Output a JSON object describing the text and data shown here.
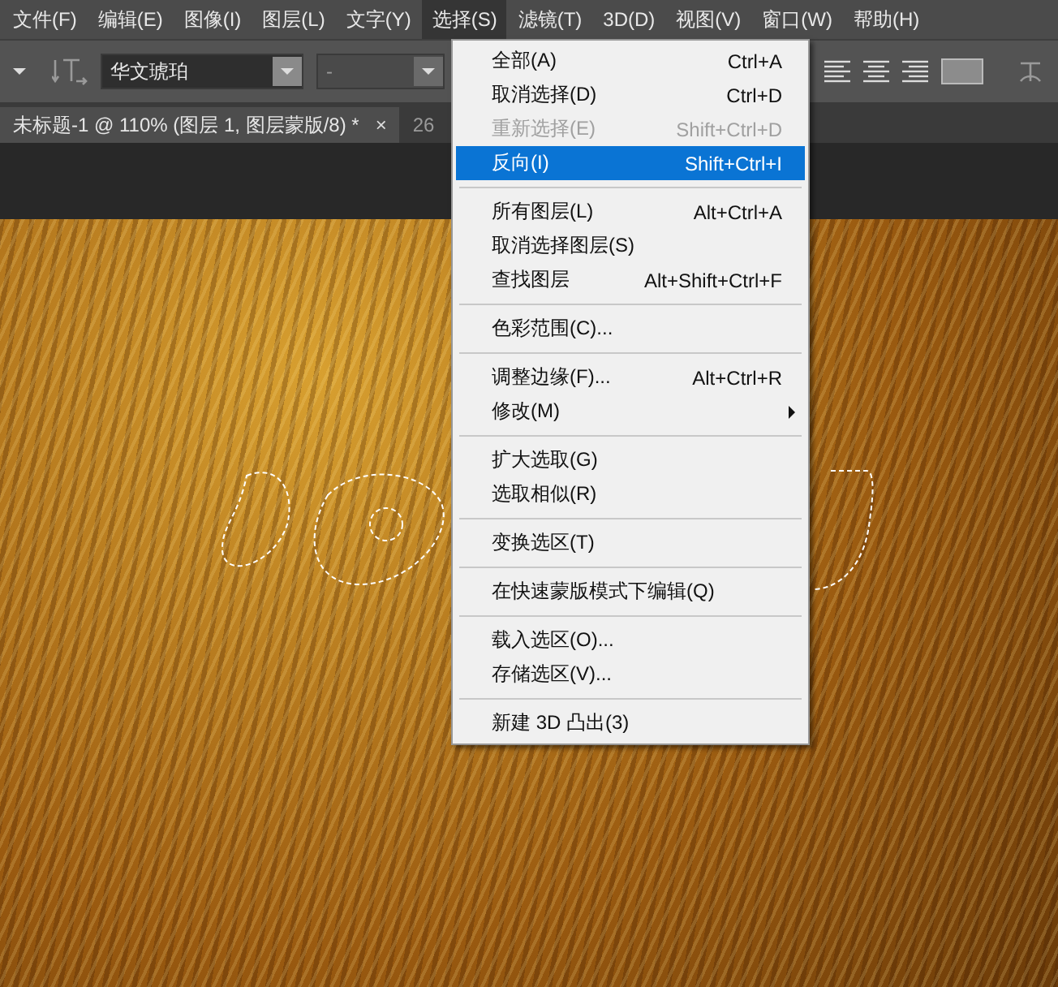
{
  "menubar": [
    {
      "label": "文件(F)",
      "selected": false
    },
    {
      "label": "编辑(E)",
      "selected": false
    },
    {
      "label": "图像(I)",
      "selected": false
    },
    {
      "label": "图层(L)",
      "selected": false
    },
    {
      "label": "文字(Y)",
      "selected": false
    },
    {
      "label": "选择(S)",
      "selected": true
    },
    {
      "label": "滤镜(T)",
      "selected": false
    },
    {
      "label": "3D(D)",
      "selected": false
    },
    {
      "label": "视图(V)",
      "selected": false
    },
    {
      "label": "窗口(W)",
      "selected": false
    },
    {
      "label": "帮助(H)",
      "selected": false
    }
  ],
  "options_bar": {
    "font_family": "华文琥珀",
    "font_style": "-"
  },
  "document_tabs": [
    {
      "label": "未标题-1 @ 110% (图层 1, 图层蒙版/8) *",
      "close": "×",
      "selected": true
    },
    {
      "label": "26",
      "selected": false
    }
  ],
  "menu": [
    {
      "kind": "item",
      "label": "全部(A)",
      "shortcut": "Ctrl+A",
      "disabled": false,
      "selected": false,
      "submenu": false
    },
    {
      "kind": "item",
      "label": "取消选择(D)",
      "shortcut": "Ctrl+D",
      "disabled": false,
      "selected": false,
      "submenu": false
    },
    {
      "kind": "item",
      "label": "重新选择(E)",
      "shortcut": "Shift+Ctrl+D",
      "disabled": true,
      "selected": false,
      "submenu": false
    },
    {
      "kind": "item",
      "label": "反向(I)",
      "shortcut": "Shift+Ctrl+I",
      "disabled": false,
      "selected": true,
      "submenu": false
    },
    {
      "kind": "separator"
    },
    {
      "kind": "item",
      "label": "所有图层(L)",
      "shortcut": "Alt+Ctrl+A",
      "disabled": false,
      "selected": false,
      "submenu": false
    },
    {
      "kind": "item",
      "label": "取消选择图层(S)",
      "disabled": false,
      "selected": false,
      "submenu": false
    },
    {
      "kind": "item",
      "label": "查找图层",
      "shortcut": "Alt+Shift+Ctrl+F",
      "disabled": false,
      "selected": false,
      "submenu": false
    },
    {
      "kind": "separator"
    },
    {
      "kind": "item",
      "label": "色彩范围(C)...",
      "disabled": false,
      "selected": false,
      "submenu": false
    },
    {
      "kind": "separator"
    },
    {
      "kind": "item",
      "label": "调整边缘(F)...",
      "shortcut": "Alt+Ctrl+R",
      "disabled": false,
      "selected": false,
      "submenu": false
    },
    {
      "kind": "item",
      "label": "修改(M)",
      "disabled": false,
      "selected": false,
      "submenu": true
    },
    {
      "kind": "separator"
    },
    {
      "kind": "item",
      "label": "扩大选取(G)",
      "disabled": false,
      "selected": false,
      "submenu": false
    },
    {
      "kind": "item",
      "label": "选取相似(R)",
      "disabled": false,
      "selected": false,
      "submenu": false
    },
    {
      "kind": "separator"
    },
    {
      "kind": "item",
      "label": "变换选区(T)",
      "disabled": false,
      "selected": false,
      "submenu": false
    },
    {
      "kind": "separator"
    },
    {
      "kind": "item",
      "label": "在快速蒙版模式下编辑(Q)",
      "disabled": false,
      "selected": false,
      "submenu": false
    },
    {
      "kind": "separator"
    },
    {
      "kind": "item",
      "label": "载入选区(O)...",
      "disabled": false,
      "selected": false,
      "submenu": false
    },
    {
      "kind": "item",
      "label": "存储选区(V)...",
      "disabled": false,
      "selected": false,
      "submenu": false
    },
    {
      "kind": "separator"
    },
    {
      "kind": "item",
      "label": "新建 3D 凸出(3)",
      "disabled": false,
      "selected": false,
      "submenu": false
    }
  ]
}
